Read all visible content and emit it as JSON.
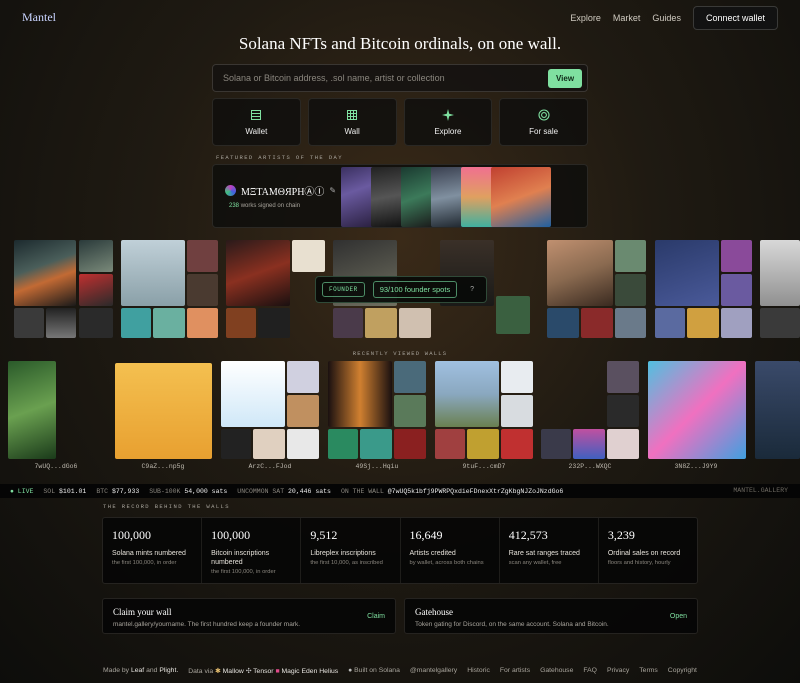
{
  "header": {
    "brand": "Mantel",
    "nav": [
      "Explore",
      "Market",
      "Guides"
    ],
    "connect_label": "Connect wallet"
  },
  "hero": {
    "headline": "Solana NFTs and Bitcoin ordinals, on one wall.",
    "search_placeholder": "Solana or Bitcoin address, .sol name, artist or collection",
    "view_label": "View"
  },
  "quick_actions": [
    {
      "label": "Wallet",
      "icon": "list-icon"
    },
    {
      "label": "Wall",
      "icon": "grid-icon"
    },
    {
      "label": "Explore",
      "icon": "sparkle-icon"
    },
    {
      "label": "For sale",
      "icon": "target-icon"
    }
  ],
  "featured": {
    "label": "FEATURED ARTISTS OF THE DAY",
    "artist_name": "ΜΞΤΑΜΘЯPHⒶⒾ",
    "works_count": "238",
    "works_text": "works signed on chain"
  },
  "founder": {
    "badge": "FOUNDER",
    "spots": "93/100 founder spots",
    "help": "?"
  },
  "recent": {
    "label": "RECENTLY VIEWED WALLS",
    "walls": [
      "7wUQ...dGo6",
      "C9aZ...np5g",
      "ArzC...FJod",
      "49Sj...Hqiu",
      "9tuF...cmD7",
      "232P...WXQC",
      "3N8Z...J9Y9"
    ]
  },
  "ticker": {
    "live": "● LIVE",
    "sol_label": "SOL",
    "sol_value": "$101.01",
    "btc_label": "BTC",
    "btc_value": "$77,933",
    "sub_label": "SUB-100K",
    "sub_value": "54,000 sats",
    "unc_label": "UNCOMMON SAT",
    "unc_value": "20,446 sats",
    "wall_label": "ON THE WALL",
    "wall_value": "@7wUQ5k1bfj9PWRPQxdieFDnexXtrZgKbgNJZoJNzdGo6",
    "site": "MANTEL.GALLERY"
  },
  "records": {
    "label": "THE RECORD BEHIND THE WALLS",
    "items": [
      {
        "n": "100,000",
        "t": "Solana mints numbered",
        "s": "the first 100,000, in order"
      },
      {
        "n": "100,000",
        "t": "Bitcoin inscriptions numbered",
        "s": "the first 100,000, in order"
      },
      {
        "n": "9,512",
        "t": "Libreplex inscriptions",
        "s": "the first 10,000, as inscribed"
      },
      {
        "n": "16,649",
        "t": "Artists credited",
        "s": "by wallet, across both chains"
      },
      {
        "n": "412,573",
        "t": "Rare sat ranges traced",
        "s": "scan any wallet, free"
      },
      {
        "n": "3,239",
        "t": "Ordinal sales on record",
        "s": "floors and history, hourly"
      }
    ]
  },
  "cta": {
    "claim_title": "Claim your wall",
    "claim_desc": "mantel.gallery/yourname. The first hundred keep a founder mark.",
    "claim_action": "Claim",
    "gate_title": "Gatehouse",
    "gate_desc": "Token gating for Discord, on the same account. Solana and Bitcoin.",
    "gate_action": "Open"
  },
  "footer": {
    "made_by": "Made by",
    "leaf": "Leaf",
    "and": "and",
    "plight": "Plight.",
    "data_via": "Data via",
    "mallow": "Mallow",
    "tensor": "Tensor",
    "me": "Magic Eden",
    "helius": "Helius",
    "built": "Built on Solana",
    "handle": "@mantelgallery",
    "historic": "Historic",
    "artists": "For artists",
    "gatehouse": "Gatehouse",
    "faq": "FAQ",
    "privacy": "Privacy",
    "terms": "Terms",
    "copyright": "Copyright"
  }
}
